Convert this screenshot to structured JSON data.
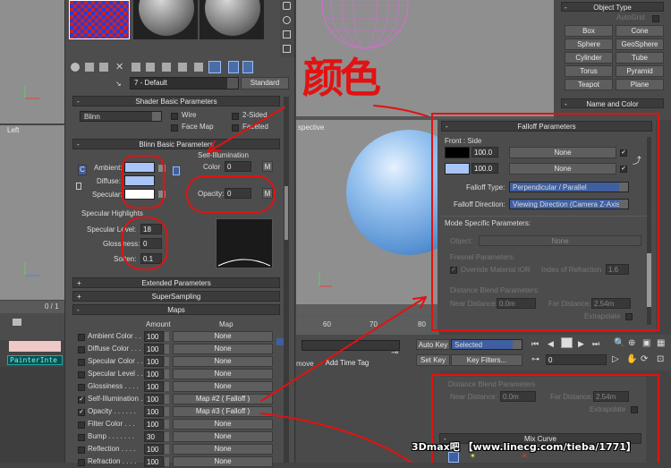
{
  "colors": {
    "annotation": "#e21212",
    "swatch_light_blue": "#a9c4f7",
    "swatch_white": "#ffffff",
    "swatch_black": "#000000",
    "viewport_grey": "#8f8f8f"
  },
  "annotation": {
    "handwritten": "颜色"
  },
  "viewport": {
    "left_label": "Left",
    "persp_label": "spective",
    "ruler": [
      "60",
      "70",
      "80"
    ]
  },
  "mid_toolbar": {
    "material_name": "7 - Default",
    "standard_button": "Standard"
  },
  "shader_basic": {
    "header": "Shader Basic Parameters",
    "shader": "Blinn",
    "wire": "Wire",
    "two_sided": "2-Sided",
    "face_map": "Face Map",
    "faceted": "Faceted"
  },
  "blinn_basic": {
    "header": "Blinn Basic Parameters",
    "self_illum_title": "Self-Illumination",
    "ambient": "Ambient:",
    "diffuse": "Diffuse:",
    "specular": "Specular:",
    "color_label": "Color",
    "color_value": "0",
    "opacity_label": "Opacity:",
    "opacity_value": "0",
    "m": "M",
    "c_btn": "C"
  },
  "specular_highlights": {
    "title": "Specular Highlights",
    "level_label": "Specular Level:",
    "level_value": "18",
    "gloss_label": "Glossiness:",
    "gloss_value": "0",
    "soften_label": "Soften:",
    "soften_value": "0.1"
  },
  "rollouts": {
    "extended": "Extended Parameters",
    "supersampling": "SuperSampling",
    "maps": "Maps"
  },
  "maps": {
    "amount_col": "Amount",
    "map_col": "Map",
    "rows": [
      {
        "label": "Ambient Color . .",
        "amount": "100",
        "map": "None",
        "checked": false
      },
      {
        "label": "Diffuse Color . . .",
        "amount": "100",
        "map": "None",
        "checked": false
      },
      {
        "label": "Specular Color . .",
        "amount": "100",
        "map": "None",
        "checked": false
      },
      {
        "label": "Specular Level . .",
        "amount": "100",
        "map": "None",
        "checked": false
      },
      {
        "label": "Glossiness . . . .",
        "amount": "100",
        "map": "None",
        "checked": false
      },
      {
        "label": "Self-Illumination .",
        "amount": "100",
        "map": "Map #2  ( Falloff )",
        "checked": true
      },
      {
        "label": "Opacity . . . . . .",
        "amount": "100",
        "map": "Map #3  ( Falloff )",
        "checked": true
      },
      {
        "label": "Filter Color . . .",
        "amount": "100",
        "map": "None",
        "checked": false
      },
      {
        "label": "Bump . . . . . . .",
        "amount": "30",
        "map": "None",
        "checked": false
      },
      {
        "label": "Reflection . . . .",
        "amount": "100",
        "map": "None",
        "checked": false
      },
      {
        "label": "Refraction . . . .",
        "amount": "100",
        "map": "None",
        "checked": false
      }
    ]
  },
  "left_strip": {
    "frame": "0 / 1",
    "painter": "PainterInte"
  },
  "command_panel": {
    "object_type": "Object Type",
    "autogrid": "AutoGrid",
    "buttons": [
      "Box",
      "Cone",
      "Sphere",
      "GeoSphere",
      "Cylinder",
      "Tube",
      "Torus",
      "Pyramid",
      "Teapot",
      "Plane"
    ],
    "name_color": "Name and Color"
  },
  "falloff": {
    "header": "Falloff Parameters",
    "front_side": "Front : Side",
    "v1": "100.0",
    "v2": "100.0",
    "none1": "None",
    "none2": "None",
    "type_label": "Falloff Type:",
    "type_value": "Perpendicular / Parallel",
    "dir_label": "Falloff Direction:",
    "dir_value": "Viewing Direction (Camera Z-Axis)",
    "mode_title": "Mode Specific Parameters:",
    "object_label": "Object:",
    "object_value": "None",
    "fresnel_title": "Fresnel Parameters:",
    "override": "Override Material IOR",
    "ior_label": "Index of Refraction",
    "ior_value": "1.6",
    "dist_title": "Distance Blend Parameters:",
    "near_label": "Near Distance:",
    "near_value": "0.0m",
    "far_label": "Far Distance:",
    "far_value": "2.54m",
    "extrapolate": "Extrapolate"
  },
  "timeline": {
    "move_label": "move",
    "add_time_tag": "Add Time Tag",
    "auto_key": "Auto Key",
    "selected": "Selected",
    "set_key": "Set Key",
    "key_filters": "Key Filters...",
    "frame": "0"
  },
  "bottom_right": {
    "dist_title": "Distance Blend Parameters",
    "near_label": "Near Distance:",
    "near_value": "0.0m",
    "far_label": "Far Distance:",
    "far_value": "2.54m",
    "extrapolate": "Extrapolate",
    "mix_curve": "Mix Curve"
  },
  "watermark": {
    "text": "3Dmax吧 【www.linecg.com/tieba/1771】"
  }
}
